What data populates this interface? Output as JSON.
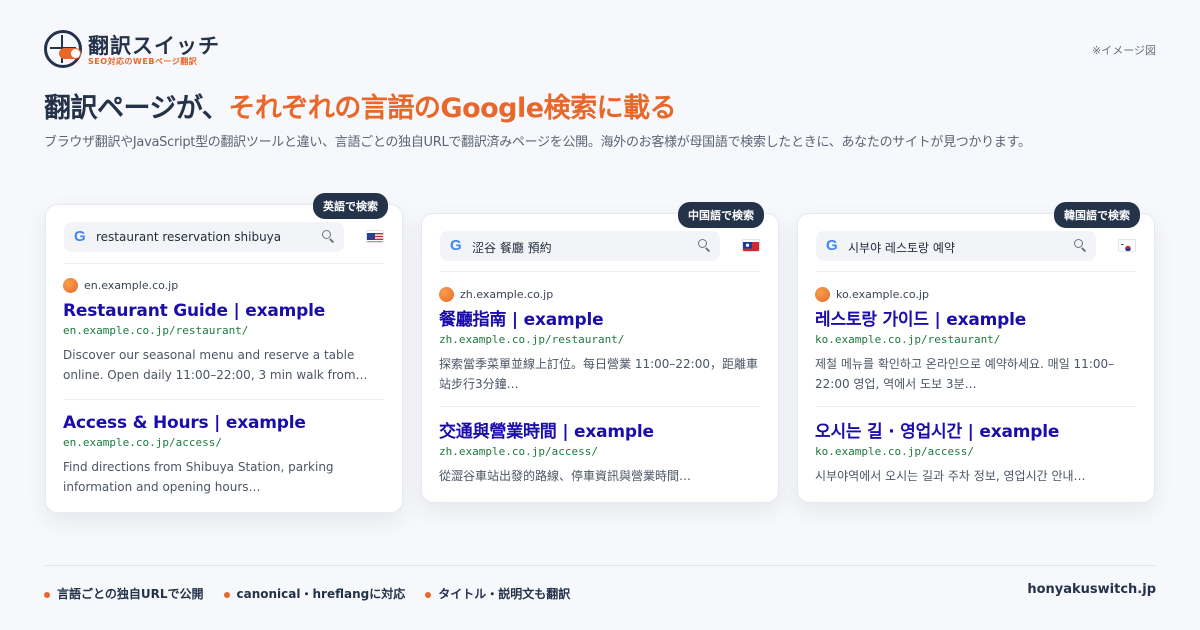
{
  "brand": {
    "name": "翻訳スイッチ",
    "tagline": "SEO対応のWEBページ翻訳"
  },
  "image_note": "※イメージ図",
  "headline": {
    "lead": "翻訳ページが、",
    "accent": "それぞれの言語のGoogle検索に載る"
  },
  "subline": "ブラウザ翻訳やJavaScript型の翻訳ツールと違い、言語ごとの独自URLで翻訳済みページを公開。海外のお客様が母国語で検索したときに、あなたのサイトが見つかります。",
  "cards": [
    {
      "tag": "英語で検索",
      "query": "restaurant reservation shibuya",
      "flag": "us-flag-icon",
      "results": [
        {
          "domain": "en.example.co.jp",
          "title": "Restaurant Guide | example",
          "url": "en.example.co.jp/restaurant/",
          "snippet": "Discover our seasonal menu and reserve a table online. Open daily 11:00–22:00, 3 min walk from…"
        },
        {
          "title": "Access & Hours | example",
          "url": "en.example.co.jp/access/",
          "snippet": "Find directions from Shibuya Station, parking information and opening hours…"
        }
      ]
    },
    {
      "tag": "中国語で検索",
      "query": "涩谷 餐廳 預約",
      "flag": "tw-flag-icon",
      "results": [
        {
          "domain": "zh.example.co.jp",
          "title": "餐廳指南 | example",
          "url": "zh.example.co.jp/restaurant/",
          "snippet": "探索當季菜單並線上訂位。每日營業 11:00–22:00，距離車站步行3分鐘…"
        },
        {
          "title": "交通與營業時間 | example",
          "url": "zh.example.co.jp/access/",
          "snippet": "從澀谷車站出發的路線、停車資訊與營業時間…"
        }
      ]
    },
    {
      "tag": "韓国語で検索",
      "query": "시부야 레스토랑 예약",
      "flag": "kr-flag-icon",
      "results": [
        {
          "domain": "ko.example.co.jp",
          "title": "레스토랑 가이드 | example",
          "url": "ko.example.co.jp/restaurant/",
          "snippet": "제철 메뉴를 확인하고 온라인으로 예약하세요. 매일 11:00–22:00 영업, 역에서 도보 3분…"
        },
        {
          "title": "오시는 길 · 영업시간 | example",
          "url": "ko.example.co.jp/access/",
          "snippet": "시부야역에서 오시는 길과 주차 정보, 영업시간 안내…"
        }
      ]
    }
  ],
  "features": [
    "言語ごとの独自URLで公開",
    "canonical・hreflangに対応",
    "タイトル・説明文も翻訳"
  ],
  "site_url": "honyakuswitch.jp",
  "colors": {
    "navy": "#24324a",
    "accent": "#e8672b",
    "result_title": "#1a0dab",
    "result_url": "#1e7a3e"
  }
}
